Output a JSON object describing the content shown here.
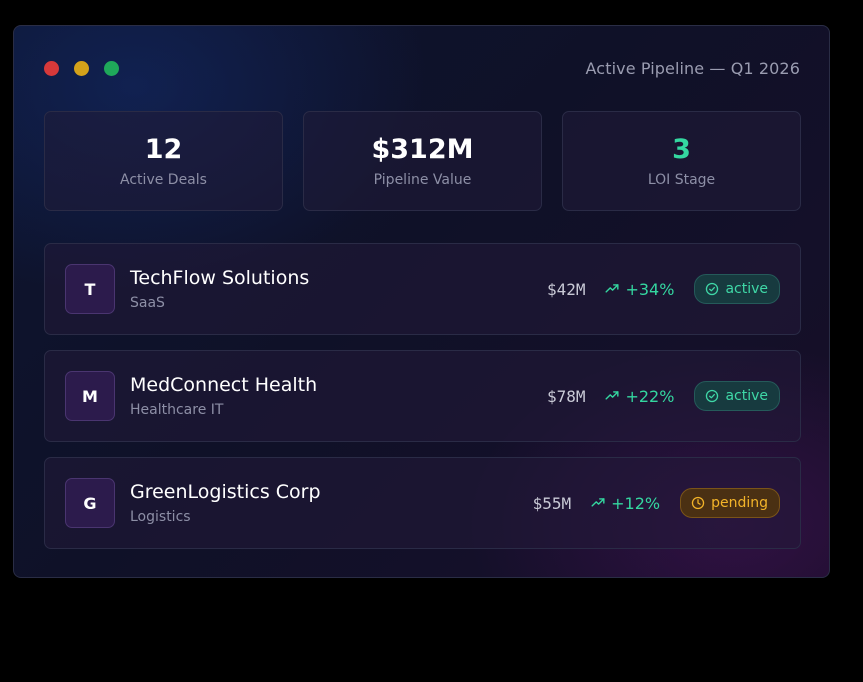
{
  "window": {
    "title": "Active Pipeline — Q1 2026"
  },
  "stats": [
    {
      "value": "12",
      "label": "Active Deals"
    },
    {
      "value": "$312M",
      "label": "Pipeline Value"
    },
    {
      "value": "3",
      "label": "LOI Stage"
    }
  ],
  "deals": [
    {
      "initial": "T",
      "name": "TechFlow Solutions",
      "sector": "SaaS",
      "amount": "$42M",
      "growth": "+34%",
      "status": "active"
    },
    {
      "initial": "M",
      "name": "MedConnect Health",
      "sector": "Healthcare IT",
      "amount": "$78M",
      "growth": "+22%",
      "status": "active"
    },
    {
      "initial": "G",
      "name": "GreenLogistics Corp",
      "sector": "Logistics",
      "amount": "$55M",
      "growth": "+12%",
      "status": "pending"
    }
  ],
  "icons": {
    "growth": "trending-up-icon",
    "active": "check-circle-icon",
    "pending": "clock-icon"
  },
  "colors": {
    "accent_green": "#34d7a0",
    "pending_amber": "#f3b429",
    "window_close": "#d6393a",
    "window_minimize": "#d4a21a",
    "window_maximize": "#1fa85a"
  }
}
